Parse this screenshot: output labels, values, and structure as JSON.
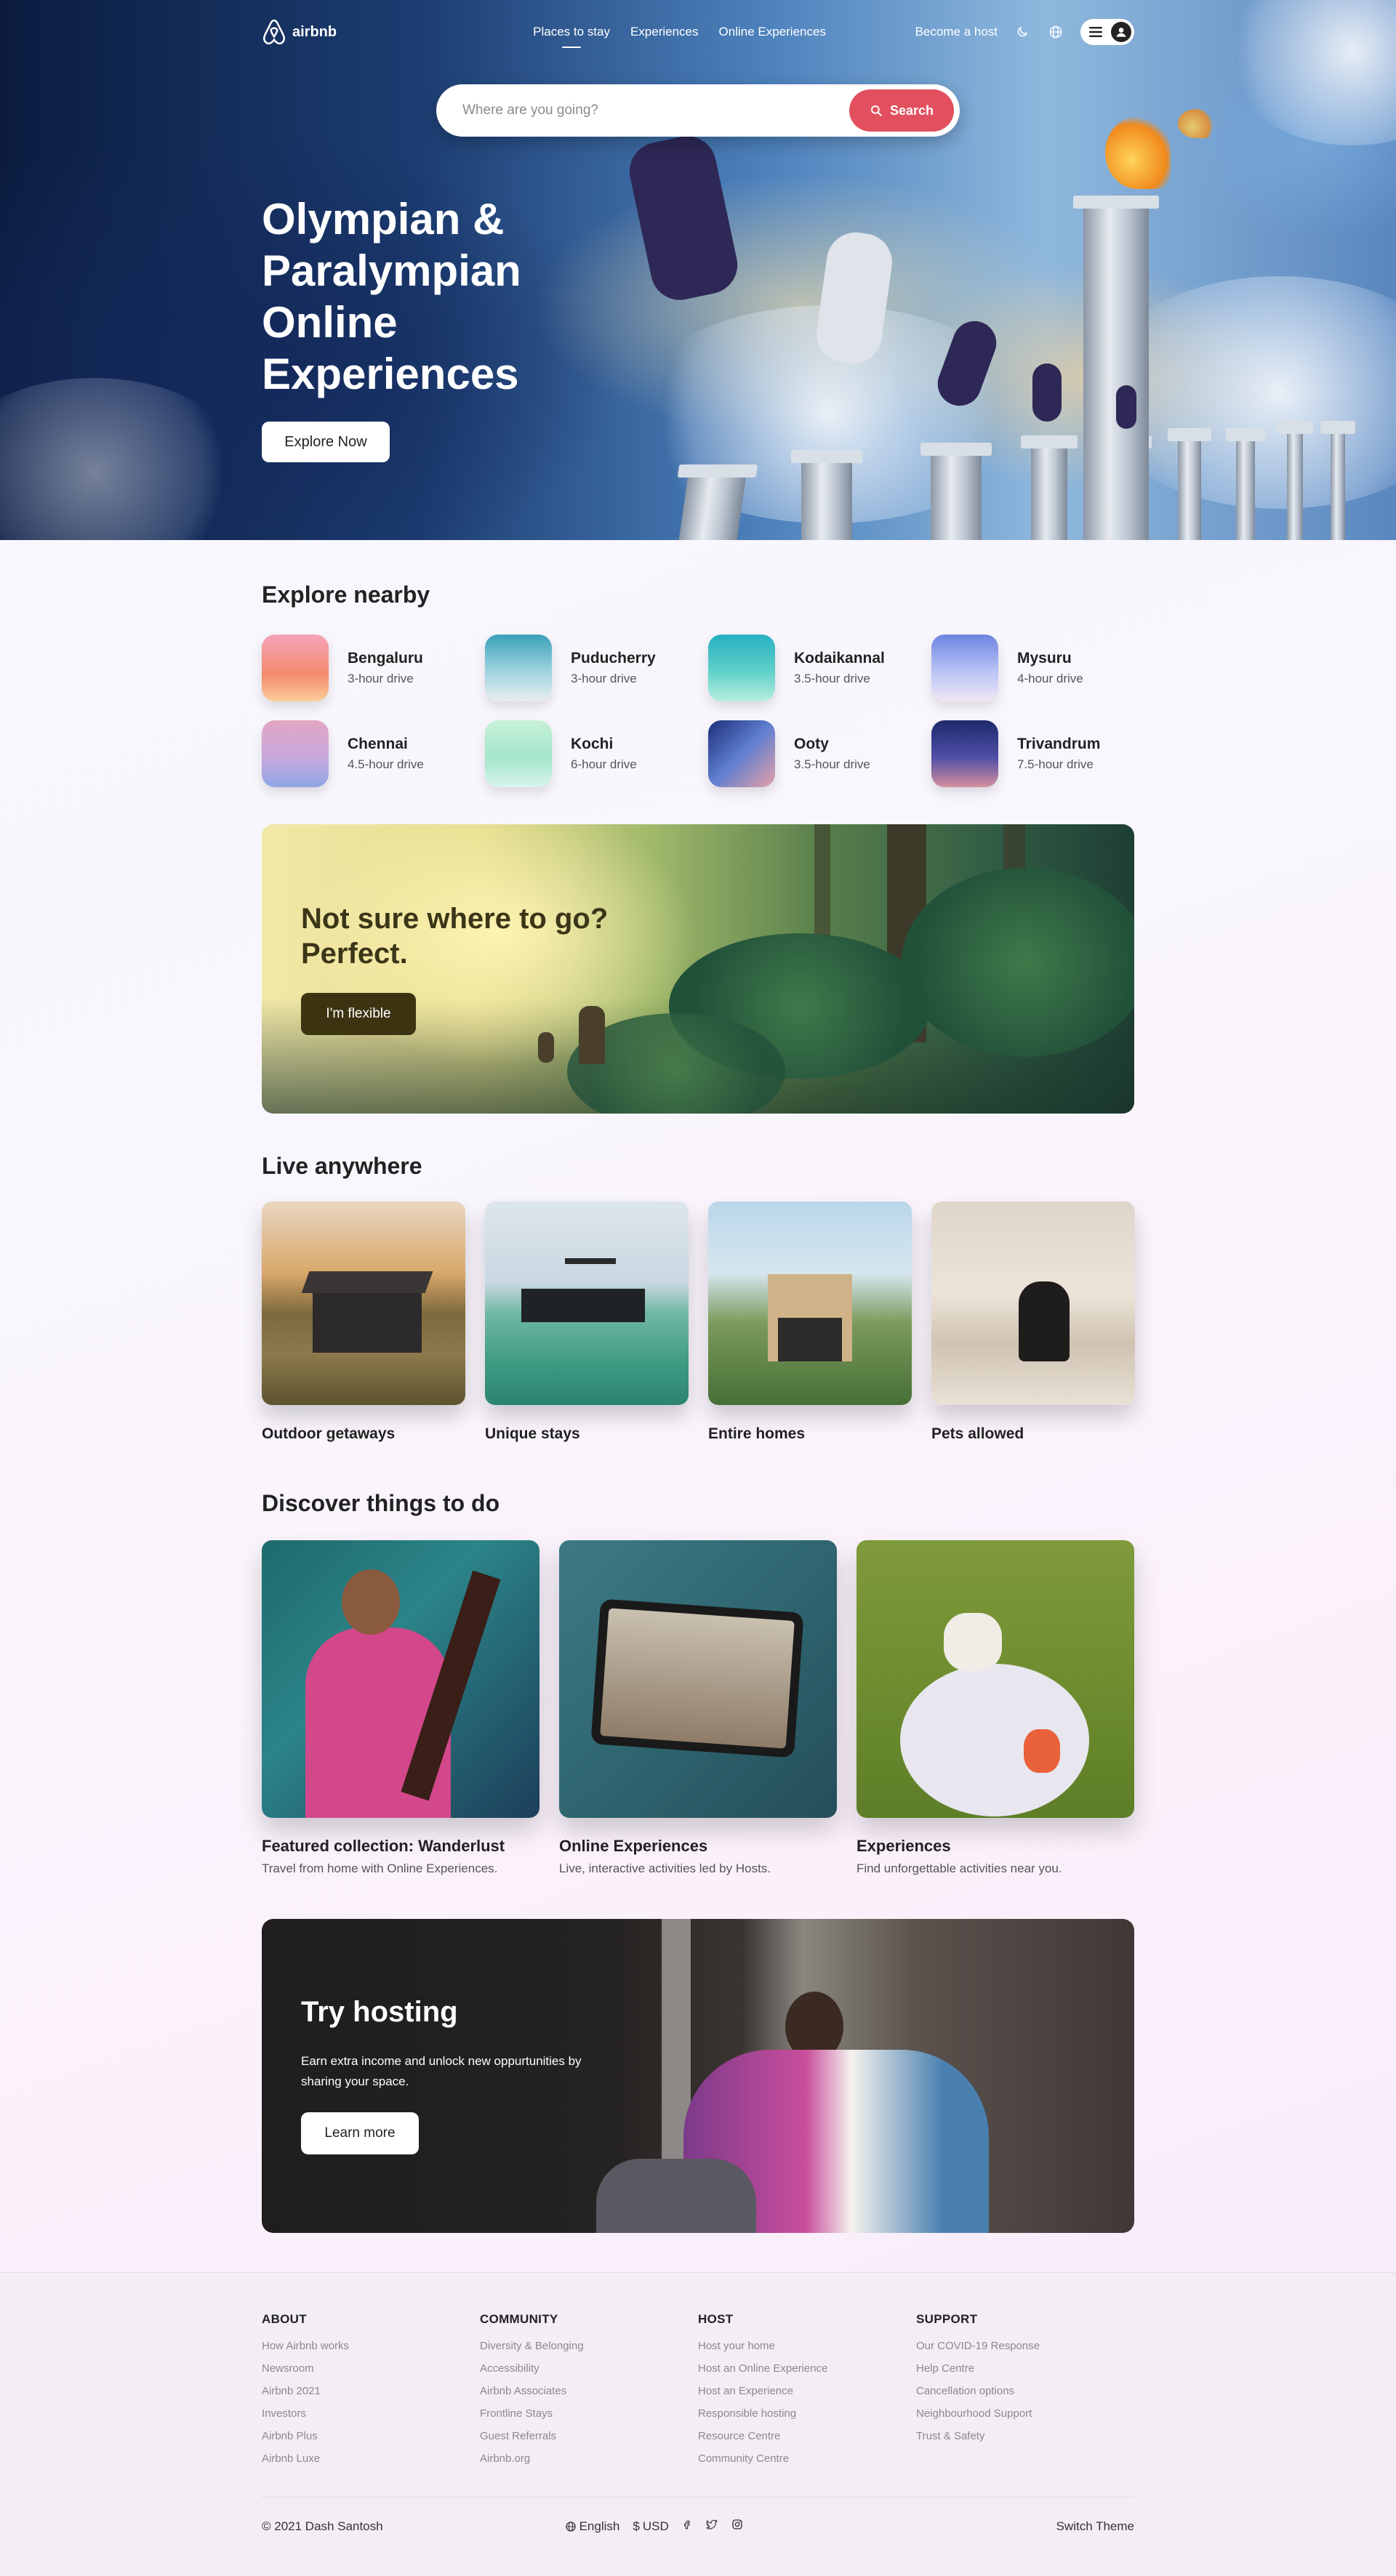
{
  "nav": {
    "brand": "airbnb",
    "links": [
      "Places to stay",
      "Experiences",
      "Online Experiences"
    ],
    "become_host": "Become a host"
  },
  "search": {
    "placeholder": "Where are you going?",
    "button": "Search"
  },
  "hero": {
    "title": "Olympian & Paralympian Online Experiences",
    "cta": "Explore Now"
  },
  "nearby": {
    "heading": "Explore nearby",
    "items": [
      {
        "name": "Bengaluru",
        "distance": "3-hour drive",
        "color": "#f08a8a"
      },
      {
        "name": "Puducherry",
        "distance": "3-hour drive",
        "color": "#5ab0c8"
      },
      {
        "name": "Kodaikannal",
        "distance": "3.5-hour drive",
        "color": "#3fb7c4"
      },
      {
        "name": "Mysuru",
        "distance": "4-hour drive",
        "color": "#8fa0e6"
      },
      {
        "name": "Chennai",
        "distance": "4.5-hour drive",
        "color": "#c99ad1"
      },
      {
        "name": "Kochi",
        "distance": "6-hour drive",
        "color": "#9fe0c0"
      },
      {
        "name": "Ooty",
        "distance": "3.5-hour drive",
        "color": "#3a4f9b"
      },
      {
        "name": "Trivandrum",
        "distance": "7.5-hour drive",
        "color": "#3c3f8a"
      }
    ]
  },
  "flexible": {
    "title": "Not sure where to go? Perfect.",
    "button": "I'm flexible"
  },
  "live": {
    "heading": "Live anywhere",
    "items": [
      "Outdoor getaways",
      "Unique stays",
      "Entire homes",
      "Pets allowed"
    ]
  },
  "discover": {
    "heading": "Discover things to do",
    "items": [
      {
        "title": "Featured collection: Wanderlust",
        "subtitle": "Travel from home with Online Experiences."
      },
      {
        "title": "Online Experiences",
        "subtitle": "Live, interactive activities led by Hosts."
      },
      {
        "title": "Experiences",
        "subtitle": "Find unforgettable activities near you."
      }
    ]
  },
  "hosting": {
    "title": "Try hosting",
    "text": "Earn extra income and unlock new oppurtunities by sharing your space.",
    "button": "Learn more"
  },
  "footer": {
    "columns": [
      {
        "title": "ABOUT",
        "links": [
          "How Airbnb works",
          "Newsroom",
          "Airbnb 2021",
          "Investors",
          "Airbnb Plus",
          "Airbnb Luxe"
        ]
      },
      {
        "title": "COMMUNITY",
        "links": [
          "Diversity & Belonging",
          "Accessibility",
          "Airbnb Associates",
          "Frontline Stays",
          "Guest Referrals",
          "Airbnb.org"
        ]
      },
      {
        "title": "HOST",
        "links": [
          "Host your home",
          "Host an Online Experience",
          "Host an Experience",
          "Responsible hosting",
          "Resource Centre",
          "Community Centre"
        ]
      },
      {
        "title": "SUPPORT",
        "links": [
          "Our COVID-19 Response",
          "Help Centre",
          "Cancellation options",
          "Neighbourhood Support",
          "Trust & Safety"
        ]
      }
    ],
    "copyright": "© 2021  Dash Santosh",
    "language": "English",
    "currency": "USD",
    "switch_theme": "Switch Theme"
  },
  "colors": {
    "accent": "#e24f5f",
    "flex_button": "#3c3411",
    "footer_bg": "#f3edf6"
  }
}
